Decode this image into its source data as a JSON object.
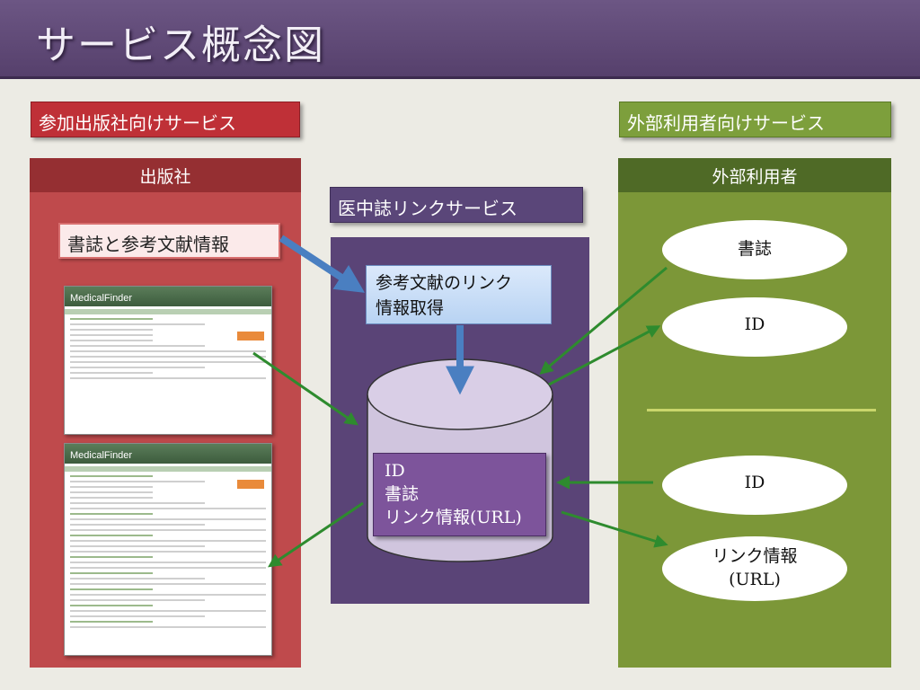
{
  "title": "サービス概念図",
  "labels": {
    "publisher_service": "参加出版社向けサービス",
    "external_service": "外部利用者向けサービス",
    "link_service": "医中誌リンクサービス"
  },
  "publisher": {
    "header": "出版社",
    "input_box": "書誌と参考文献情報",
    "screenshot_brand": "MedicalFinder"
  },
  "center": {
    "fetch_line1": "参考文献のリンク",
    "fetch_line2": "情報取得",
    "db_line1": "ID",
    "db_line2": "書誌",
    "db_line3": "リンク情報(URL)"
  },
  "external": {
    "header": "外部利用者",
    "item_shoshi": "書誌",
    "item_id_top": "ID",
    "item_id_bottom": "ID",
    "item_link_line1": "リンク情報",
    "item_link_line2": "(URL)"
  },
  "colors": {
    "publisher_red": "#bf3037",
    "external_green": "#7d9f3c",
    "link_service_purple": "#5a4679",
    "arrow_blue": "#4a7fc1",
    "arrow_green": "#2e8b2e"
  }
}
